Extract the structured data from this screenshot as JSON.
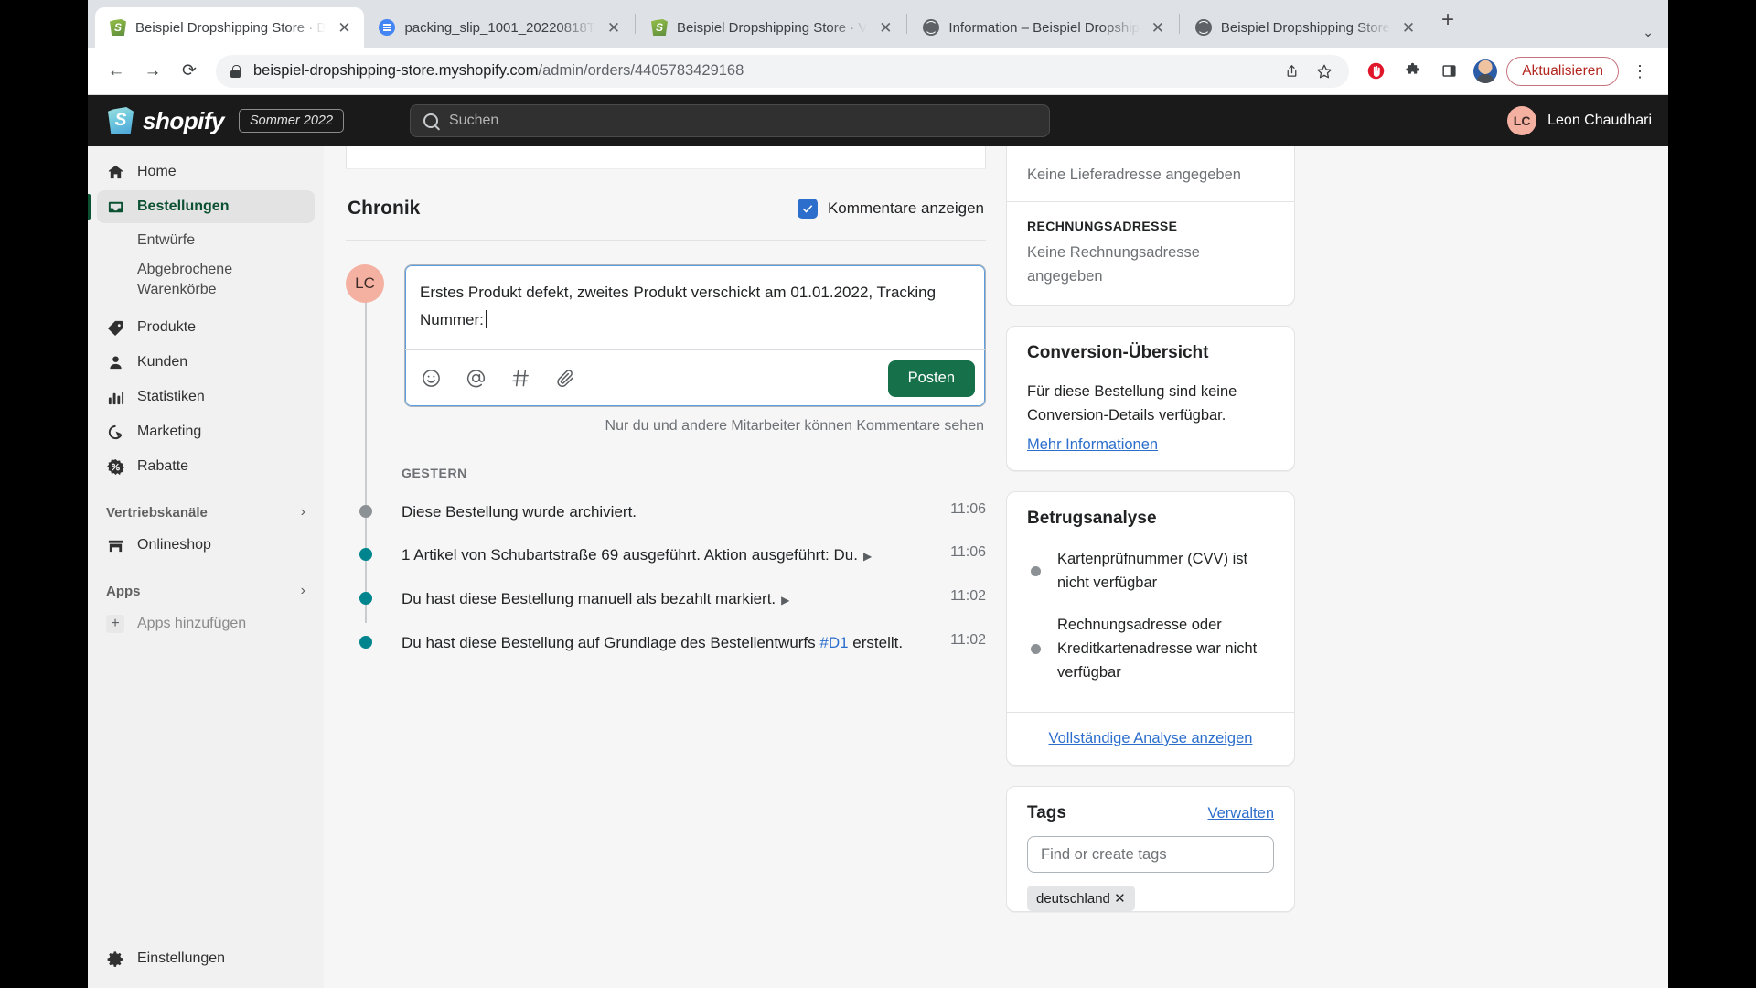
{
  "browser": {
    "tabs": [
      {
        "title": "Beispiel Dropshipping Store · B",
        "icon": "shopify-favicon",
        "active": true
      },
      {
        "title": "packing_slip_1001_20220818T",
        "icon": "document-favicon",
        "active": false
      },
      {
        "title": "Beispiel Dropshipping Store · V",
        "icon": "shopify-favicon",
        "active": false
      },
      {
        "title": "Information – Beispiel Dropship",
        "icon": "globe-favicon",
        "active": false
      },
      {
        "title": "Beispiel Dropshipping Store",
        "icon": "globe-favicon",
        "active": false
      }
    ],
    "new_tab_label": "+",
    "tab_close_label": "✕",
    "tabstrip_chevron": "⌄",
    "url_domain": "beispiel-dropshipping-store.myshopify.com",
    "url_path": "/admin/orders/4405783429168",
    "update_button": "Aktualisieren",
    "back_icon": "←",
    "forward_icon": "→",
    "reload_icon": "⟳",
    "share_icon": "share-icon",
    "bookmark_icon": "star-icon",
    "adblock_icon": "adblock-icon",
    "extensions_icon": "puzzle-icon",
    "sidepanel_icon": "side-panel-icon",
    "menu_icon": "⋮"
  },
  "topbar": {
    "brand": "shopify",
    "season_badge": "Sommer 2022",
    "search_placeholder": "Suchen",
    "user_initials": "LC",
    "user_name": "Leon Chaudhari"
  },
  "sidebar": {
    "items": [
      {
        "label": "Home",
        "icon": "home-icon",
        "type": "item",
        "active": false
      },
      {
        "label": "Bestellungen",
        "icon": "orders-icon",
        "type": "item",
        "active": true
      },
      {
        "label": "Entwürfe",
        "type": "sub"
      },
      {
        "label": "Abgebrochene Warenkörbe",
        "type": "sub-two-line"
      },
      {
        "label": "Produkte",
        "icon": "product-tag-icon",
        "type": "item",
        "active": false
      },
      {
        "label": "Kunden",
        "icon": "customer-icon",
        "type": "item",
        "active": false
      },
      {
        "label": "Statistiken",
        "icon": "analytics-icon",
        "type": "item",
        "active": false
      },
      {
        "label": "Marketing",
        "icon": "marketing-icon",
        "type": "item",
        "active": false
      },
      {
        "label": "Rabatte",
        "icon": "discount-icon",
        "type": "item",
        "active": false
      }
    ],
    "section_channels": "Vertriebskanäle",
    "online_store": "Onlineshop",
    "section_apps": "Apps",
    "add_apps": "Apps hinzufügen",
    "settings": "Einstellungen",
    "chevron": "›",
    "plus": "+"
  },
  "timeline": {
    "title": "Chronik",
    "show_comments_label": "Kommentare anzeigen",
    "show_comments_checked": true,
    "composer": {
      "avatar_initials": "LC",
      "text": "Erstes Produkt defekt, zweites Produkt verschickt am 01.01.2022, Tracking Nummer:",
      "post_button": "Posten",
      "hint": "Nur du und andere Mitarbeiter können Kommentare sehen",
      "toolbar_icons": [
        "emoji-icon",
        "mention-icon",
        "hashtag-icon",
        "attachment-icon"
      ]
    },
    "date_group": "GESTERN",
    "events": [
      {
        "text": "Diese Bestellung wurde archiviert.",
        "time": "11:06",
        "dot": "#8c9196",
        "expandable": false
      },
      {
        "text": "1 Artikel von Schubartstraße 69 ausgeführt. Aktion ausgeführt: Du.",
        "time": "11:06",
        "dot": "#00848e",
        "expandable": true
      },
      {
        "text": "Du hast diese Bestellung manuell als bezahlt markiert.",
        "time": "11:02",
        "dot": "#00848e",
        "expandable": true
      },
      {
        "text": "Du hast diese Bestellung auf Grundlage des Bestellentwurfs ",
        "link": "#D1",
        "text_after": " erstellt.",
        "time": "11:02",
        "dot": "#00848e",
        "expandable": false
      }
    ]
  },
  "right_panel": {
    "address_card": {
      "shipping_empty": "Keine Lieferadresse angegeben",
      "billing_label": "RECHNUNGSADRESSE",
      "billing_empty": "Keine Rechnungsadresse angegeben"
    },
    "conversion": {
      "title": "Conversion-Übersicht",
      "body": "Für diese Bestellung sind keine Conversion-Details verfügbar.",
      "link": "Mehr Informationen"
    },
    "fraud": {
      "title": "Betrugsanalyse",
      "items": [
        "Kartenprüfnummer (CVV) ist nicht verfügbar",
        "Rechnungsadresse oder Kreditkartenadresse war nicht verfügbar"
      ],
      "footer_link": "Vollständige Analyse anzeigen"
    },
    "tags": {
      "title": "Tags",
      "manage": "Verwalten",
      "input_placeholder": "Find or create tags",
      "chip": "deutschland ✕"
    }
  },
  "colors": {
    "shopify_green": "#16714b",
    "accent_blue": "#2c6ecb",
    "teal_dot": "#00848e",
    "gray_dot": "#8c9196"
  }
}
